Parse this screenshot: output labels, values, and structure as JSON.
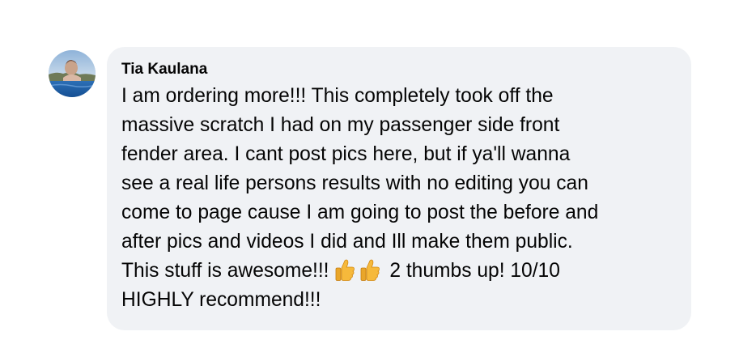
{
  "comment": {
    "author": "Tia Kaulana",
    "lines": [
      "I am ordering more!!! This completely took off the",
      "massive scratch I had on my passenger side front",
      "fender area. I cant post pics here, but if ya'll wanna",
      "see a real life persons results with no editing you can",
      "come to page cause I am going to post the before and",
      "after pics and videos I did and Ill make them public."
    ],
    "line7_before_emoji": "This stuff is awesome!!! ",
    "emoji": [
      "thumbs-up-icon",
      "thumbs-up-icon"
    ],
    "line7_after_emoji": "2 thumbs up! 10/10",
    "line8": "HIGHLY recommend!!!",
    "avatar_icon": "avatar-photo",
    "colors": {
      "bubble": "#f0f2f5",
      "text": "#050505",
      "emoji": "#f6b93b"
    }
  }
}
